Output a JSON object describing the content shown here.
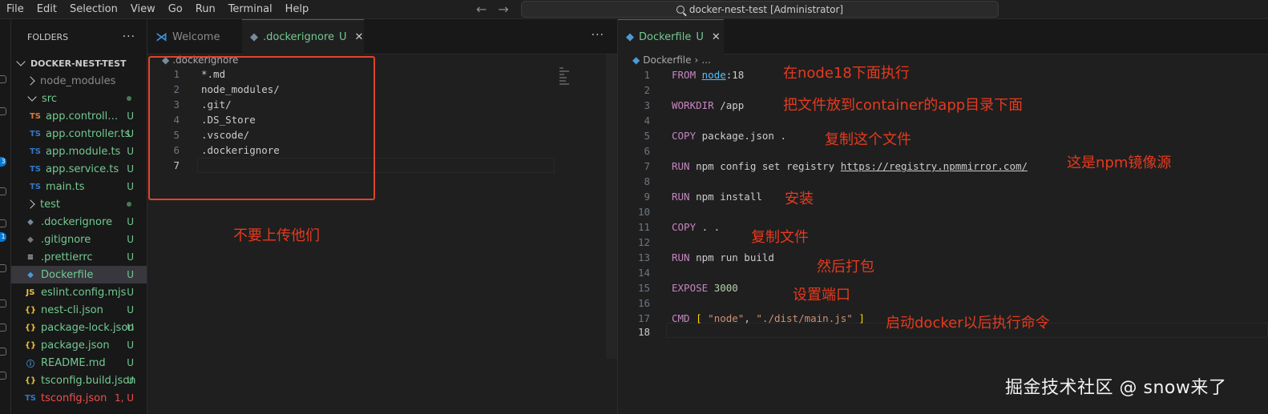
{
  "menu": [
    "File",
    "Edit",
    "Selection",
    "View",
    "Go",
    "Run",
    "Terminal",
    "Help"
  ],
  "command_center": {
    "title": "docker-nest-test [Administrator]"
  },
  "sidebar": {
    "header": "FOLDERS",
    "root": "DOCKER-NEST-TEST",
    "items": [
      {
        "label": "node_modules",
        "type": "folder",
        "expanded": false,
        "status": ""
      },
      {
        "label": "src",
        "type": "folder",
        "expanded": true,
        "status": "dot"
      },
      {
        "label": "app.controller.s...",
        "type": "ts-orange",
        "status": "U"
      },
      {
        "label": "app.controller.ts",
        "type": "ts",
        "status": "U"
      },
      {
        "label": "app.module.ts",
        "type": "ts",
        "status": "U"
      },
      {
        "label": "app.service.ts",
        "type": "ts",
        "status": "U"
      },
      {
        "label": "main.ts",
        "type": "ts",
        "status": "U"
      },
      {
        "label": "test",
        "type": "folder",
        "expanded": false,
        "status": "dot"
      },
      {
        "label": ".dockerignore",
        "type": "docker-gray",
        "status": "U"
      },
      {
        "label": ".gitignore",
        "type": "git",
        "status": "U"
      },
      {
        "label": ".prettierrc",
        "type": "lines",
        "status": "U"
      },
      {
        "label": "Dockerfile",
        "type": "docker",
        "status": "U"
      },
      {
        "label": "eslint.config.mjs",
        "type": "js",
        "status": "U"
      },
      {
        "label": "nest-cli.json",
        "type": "json",
        "status": "U"
      },
      {
        "label": "package-lock.json",
        "type": "json",
        "status": "U"
      },
      {
        "label": "package.json",
        "type": "json",
        "status": "U"
      },
      {
        "label": "README.md",
        "type": "info",
        "status": "U"
      },
      {
        "label": "tsconfig.build.json",
        "type": "json",
        "status": "U"
      },
      {
        "label": "tsconfig.json",
        "type": "tsconfig",
        "status": "1, U"
      }
    ]
  },
  "left_editor": {
    "tabs": [
      {
        "label": "Welcome",
        "status": ""
      },
      {
        "label": ".dockerignore",
        "status": "U"
      }
    ],
    "breadcrumb": ".dockerignore",
    "lines": [
      "*.md",
      "node_modules/",
      ".git/",
      ".DS_Store",
      ".vscode/",
      ".dockerignore",
      ""
    ],
    "annotation": "不要上传他们"
  },
  "right_editor": {
    "tab": {
      "label": "Dockerfile",
      "status": "U"
    },
    "breadcrumb": [
      "Dockerfile",
      "..."
    ],
    "annotations": [
      "在node18下面执行",
      "把文件放到container的app目录下面",
      "复制这个文件",
      "这是npm镜像源",
      "安装",
      "复制文件",
      "然后打包",
      "设置端口",
      "启动docker以后执行命令"
    ]
  },
  "watermark": "掘金技术社区 @ snow来了"
}
